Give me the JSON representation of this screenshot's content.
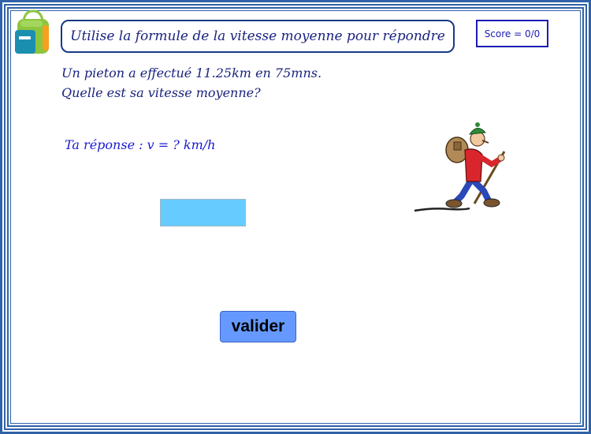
{
  "instruction": "Utilise la formule de la vitesse moyenne pour répondre",
  "score": "Score = 0/0",
  "question": {
    "line1": "Un pieton a effectué 11.25km en 75mns.",
    "line2": "Quelle est sa vitesse moyenne?"
  },
  "answer": {
    "prompt": "Ta réponse : v =  ? km/h",
    "value": ""
  },
  "validate_label": "valider",
  "icons": {
    "bag": "school-backpack-icon",
    "hiker": "hiker-illustration"
  },
  "colors": {
    "frame": "#2f62a8",
    "input": "#66ccff",
    "button": "#6699ff",
    "text": "#1a237e"
  }
}
